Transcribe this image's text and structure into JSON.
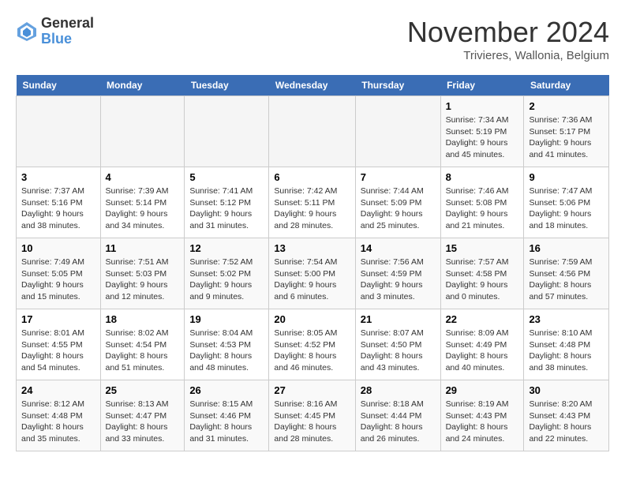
{
  "logo": {
    "general": "General",
    "blue": "Blue"
  },
  "title": "November 2024",
  "subtitle": "Trivieres, Wallonia, Belgium",
  "days_header": [
    "Sunday",
    "Monday",
    "Tuesday",
    "Wednesday",
    "Thursday",
    "Friday",
    "Saturday"
  ],
  "weeks": [
    [
      {
        "day": "",
        "info": ""
      },
      {
        "day": "",
        "info": ""
      },
      {
        "day": "",
        "info": ""
      },
      {
        "day": "",
        "info": ""
      },
      {
        "day": "",
        "info": ""
      },
      {
        "day": "1",
        "info": "Sunrise: 7:34 AM\nSunset: 5:19 PM\nDaylight: 9 hours and 45 minutes."
      },
      {
        "day": "2",
        "info": "Sunrise: 7:36 AM\nSunset: 5:17 PM\nDaylight: 9 hours and 41 minutes."
      }
    ],
    [
      {
        "day": "3",
        "info": "Sunrise: 7:37 AM\nSunset: 5:16 PM\nDaylight: 9 hours and 38 minutes."
      },
      {
        "day": "4",
        "info": "Sunrise: 7:39 AM\nSunset: 5:14 PM\nDaylight: 9 hours and 34 minutes."
      },
      {
        "day": "5",
        "info": "Sunrise: 7:41 AM\nSunset: 5:12 PM\nDaylight: 9 hours and 31 minutes."
      },
      {
        "day": "6",
        "info": "Sunrise: 7:42 AM\nSunset: 5:11 PM\nDaylight: 9 hours and 28 minutes."
      },
      {
        "day": "7",
        "info": "Sunrise: 7:44 AM\nSunset: 5:09 PM\nDaylight: 9 hours and 25 minutes."
      },
      {
        "day": "8",
        "info": "Sunrise: 7:46 AM\nSunset: 5:08 PM\nDaylight: 9 hours and 21 minutes."
      },
      {
        "day": "9",
        "info": "Sunrise: 7:47 AM\nSunset: 5:06 PM\nDaylight: 9 hours and 18 minutes."
      }
    ],
    [
      {
        "day": "10",
        "info": "Sunrise: 7:49 AM\nSunset: 5:05 PM\nDaylight: 9 hours and 15 minutes."
      },
      {
        "day": "11",
        "info": "Sunrise: 7:51 AM\nSunset: 5:03 PM\nDaylight: 9 hours and 12 minutes."
      },
      {
        "day": "12",
        "info": "Sunrise: 7:52 AM\nSunset: 5:02 PM\nDaylight: 9 hours and 9 minutes."
      },
      {
        "day": "13",
        "info": "Sunrise: 7:54 AM\nSunset: 5:00 PM\nDaylight: 9 hours and 6 minutes."
      },
      {
        "day": "14",
        "info": "Sunrise: 7:56 AM\nSunset: 4:59 PM\nDaylight: 9 hours and 3 minutes."
      },
      {
        "day": "15",
        "info": "Sunrise: 7:57 AM\nSunset: 4:58 PM\nDaylight: 9 hours and 0 minutes."
      },
      {
        "day": "16",
        "info": "Sunrise: 7:59 AM\nSunset: 4:56 PM\nDaylight: 8 hours and 57 minutes."
      }
    ],
    [
      {
        "day": "17",
        "info": "Sunrise: 8:01 AM\nSunset: 4:55 PM\nDaylight: 8 hours and 54 minutes."
      },
      {
        "day": "18",
        "info": "Sunrise: 8:02 AM\nSunset: 4:54 PM\nDaylight: 8 hours and 51 minutes."
      },
      {
        "day": "19",
        "info": "Sunrise: 8:04 AM\nSunset: 4:53 PM\nDaylight: 8 hours and 48 minutes."
      },
      {
        "day": "20",
        "info": "Sunrise: 8:05 AM\nSunset: 4:52 PM\nDaylight: 8 hours and 46 minutes."
      },
      {
        "day": "21",
        "info": "Sunrise: 8:07 AM\nSunset: 4:50 PM\nDaylight: 8 hours and 43 minutes."
      },
      {
        "day": "22",
        "info": "Sunrise: 8:09 AM\nSunset: 4:49 PM\nDaylight: 8 hours and 40 minutes."
      },
      {
        "day": "23",
        "info": "Sunrise: 8:10 AM\nSunset: 4:48 PM\nDaylight: 8 hours and 38 minutes."
      }
    ],
    [
      {
        "day": "24",
        "info": "Sunrise: 8:12 AM\nSunset: 4:48 PM\nDaylight: 8 hours and 35 minutes."
      },
      {
        "day": "25",
        "info": "Sunrise: 8:13 AM\nSunset: 4:47 PM\nDaylight: 8 hours and 33 minutes."
      },
      {
        "day": "26",
        "info": "Sunrise: 8:15 AM\nSunset: 4:46 PM\nDaylight: 8 hours and 31 minutes."
      },
      {
        "day": "27",
        "info": "Sunrise: 8:16 AM\nSunset: 4:45 PM\nDaylight: 8 hours and 28 minutes."
      },
      {
        "day": "28",
        "info": "Sunrise: 8:18 AM\nSunset: 4:44 PM\nDaylight: 8 hours and 26 minutes."
      },
      {
        "day": "29",
        "info": "Sunrise: 8:19 AM\nSunset: 4:43 PM\nDaylight: 8 hours and 24 minutes."
      },
      {
        "day": "30",
        "info": "Sunrise: 8:20 AM\nSunset: 4:43 PM\nDaylight: 8 hours and 22 minutes."
      }
    ]
  ]
}
